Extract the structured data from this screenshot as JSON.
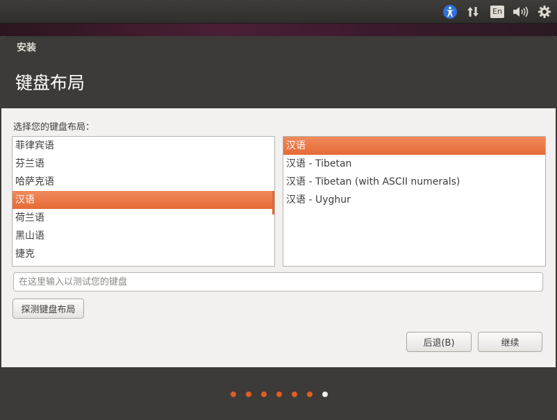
{
  "panel": {
    "accessibility_icon": "universal-access-icon",
    "network_icon": "network-arrows-icon",
    "keyboard_layout_label": "En",
    "sound_icon": "volume-icon",
    "settings_icon": "gear-icon"
  },
  "window": {
    "title": "安装",
    "page_title": "键盘布局"
  },
  "layout": {
    "prompt": "选择您的键盘布局：",
    "languages": [
      "菲律宾语",
      "芬兰语",
      "哈萨克语",
      "汉语",
      "荷兰语",
      "黑山语",
      "捷克"
    ],
    "selected_language": "汉语",
    "variants": [
      "汉语",
      "汉语 - Tibetan",
      "汉语 - Tibetan (with ASCII numerals)",
      "汉语 - Uyghur"
    ],
    "selected_variant": "汉语"
  },
  "test_input": {
    "placeholder": "在这里输入以测试您的键盘",
    "value": ""
  },
  "buttons": {
    "detect": "探测键盘布局",
    "back": "后退(B)",
    "continue": "继续"
  },
  "progress": {
    "total_steps": 7,
    "current_step": 7
  },
  "colors": {
    "accent": "#e56a36",
    "dark_panel": "#3c3b37",
    "window_bg": "#f2f1f0"
  }
}
